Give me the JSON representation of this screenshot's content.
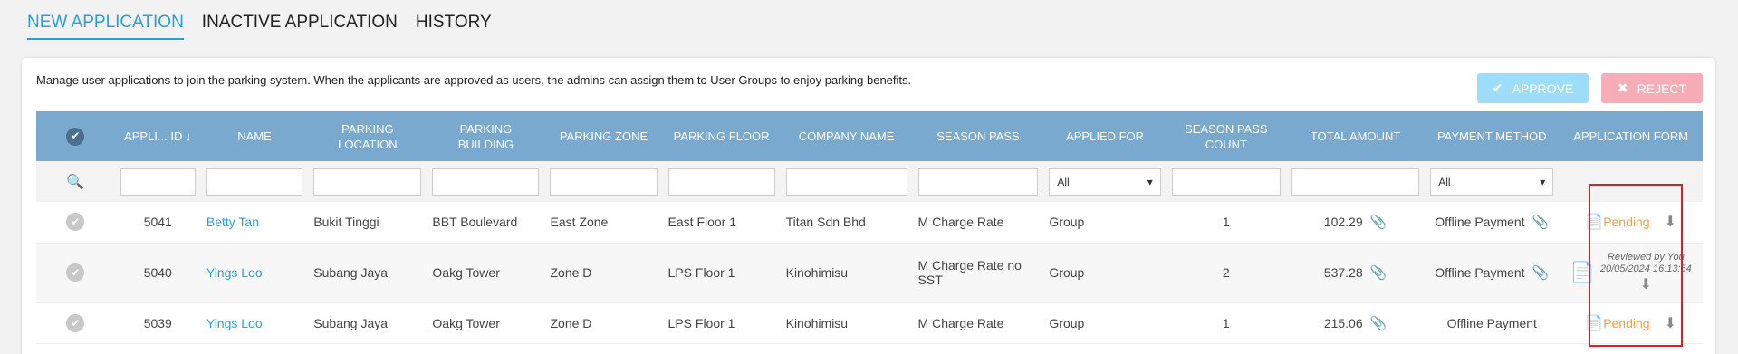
{
  "tabs": [
    {
      "label": "NEW APPLICATION"
    },
    {
      "label": "INACTIVE APPLICATION"
    },
    {
      "label": "HISTORY"
    }
  ],
  "description": "Manage user applications to join the parking system. When the applicants are approved as users, the admins can assign them to User Groups to enjoy parking benefits.",
  "buttons": {
    "approve": "APPROVE",
    "reject": "REJECT"
  },
  "columns": [
    "APPLI... ID",
    "NAME",
    "PARKING LOCATION",
    "PARKING BUILDING",
    "PARKING ZONE",
    "PARKING FLOOR",
    "COMPANY NAME",
    "SEASON PASS",
    "APPLIED FOR",
    "SEASON PASS COUNT",
    "TOTAL AMOUNT",
    "PAYMENT METHOD",
    "APPLICATION FORM"
  ],
  "filters": {
    "applied_for": "All",
    "payment_method": "All"
  },
  "rows": [
    {
      "id": "5041",
      "name": "Betty Tan",
      "location": "Bukit Tinggi",
      "building": "BBT Boulevard",
      "zone": "East Zone",
      "floor": "East Floor 1",
      "company": "Titan Sdn Bhd",
      "season_pass": "M Charge Rate",
      "applied_for": "Group",
      "count": "1",
      "amount": "102.29",
      "payment": "Offline Payment",
      "form_status": "Pending"
    },
    {
      "id": "5040",
      "name": "Yings Loo",
      "location": "Subang Jaya",
      "building": "Oakg Tower",
      "zone": "Zone D",
      "floor": "LPS Floor 1",
      "company": "Kinohimisu",
      "season_pass": "M Charge Rate no SST",
      "applied_for": "Group",
      "count": "2",
      "amount": "537.28",
      "payment": "Offline Payment",
      "reviewed_by": "Reviewed by You",
      "reviewed_at": "20/05/2024 16:13:54"
    },
    {
      "id": "5039",
      "name": "Yings Loo",
      "location": "Subang Jaya",
      "building": "Oakg Tower",
      "zone": "Zone D",
      "floor": "LPS Floor 1",
      "company": "Kinohimisu",
      "season_pass": "M Charge Rate",
      "applied_for": "Group",
      "count": "1",
      "amount": "215.06",
      "payment": "Offline Payment",
      "form_status": "Pending"
    }
  ],
  "colors": {
    "accent": "#2a9fd6",
    "header": "#7aa9cf",
    "pending": "#f5a142",
    "highlight": "#d9202a"
  }
}
